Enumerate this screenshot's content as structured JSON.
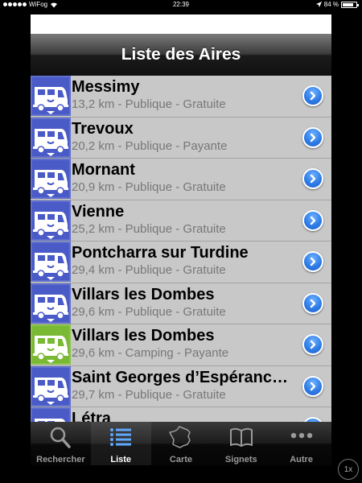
{
  "status": {
    "carrier": "WiFog",
    "time": "22:39",
    "battery": "84 %",
    "battery_level": 0.84
  },
  "navbar": {
    "title": "Liste des Aires"
  },
  "colors": {
    "icon_public": "#4a5bc7",
    "icon_camping": "#7ab934",
    "disclosure": "#2f7de8"
  },
  "list": [
    {
      "name": "Messimy",
      "sub": "13,2 km - Publique - Gratuite",
      "icon": "camper-van-icon",
      "kind": "public"
    },
    {
      "name": "Trevoux",
      "sub": "20,2 km - Publique - Payante",
      "icon": "camper-van-icon",
      "kind": "public"
    },
    {
      "name": "Mornant",
      "sub": "20,9 km - Publique - Gratuite",
      "icon": "camper-van-icon",
      "kind": "public"
    },
    {
      "name": "Vienne",
      "sub": "25,2 km - Publique - Gratuite",
      "icon": "camper-van-icon",
      "kind": "public"
    },
    {
      "name": "Pontcharra sur Turdine",
      "sub": "29,4 km - Publique - Gratuite",
      "icon": "camper-van-icon",
      "kind": "public"
    },
    {
      "name": "Villars les Dombes",
      "sub": "29,6 km - Publique - Gratuite",
      "icon": "camper-van-icon",
      "kind": "public"
    },
    {
      "name": "Villars les Dombes",
      "sub": "29,6 km - Camping - Payante",
      "icon": "camper-van-icon",
      "kind": "camping"
    },
    {
      "name": "Saint Georges d’Espéranc…",
      "sub": "29,7 km - Publique - Gratuite",
      "icon": "camper-van-icon",
      "kind": "public"
    },
    {
      "name": "Létra",
      "sub": "",
      "icon": "camper-van-icon",
      "kind": "public"
    }
  ],
  "tabs": [
    {
      "label": "Rechercher",
      "icon": "search-icon",
      "active": false
    },
    {
      "label": "Liste",
      "icon": "list-icon",
      "active": true
    },
    {
      "label": "Carte",
      "icon": "france-map-icon",
      "active": false
    },
    {
      "label": "Signets",
      "icon": "book-icon",
      "active": false
    },
    {
      "label": "Autre",
      "icon": "more-icon",
      "active": false
    }
  ],
  "zoom_button": {
    "label": "1x"
  }
}
